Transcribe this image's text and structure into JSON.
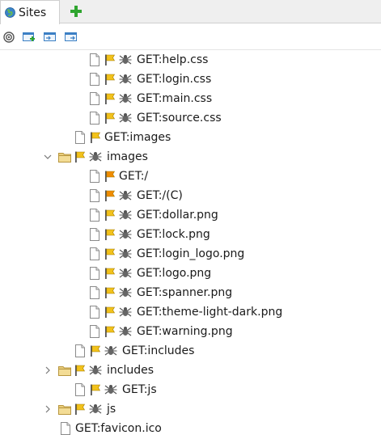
{
  "tab": {
    "label": "Sites",
    "icon": "globe-icon"
  },
  "toolbar": {
    "buttons": [
      "target-icon",
      "new-context-icon",
      "import-icon",
      "export-icon"
    ]
  },
  "tree": {
    "nodes": [
      {
        "label": "GET:help.css",
        "type": "file",
        "flag": true,
        "spider": true
      },
      {
        "label": "GET:login.css",
        "type": "file",
        "flag": true,
        "spider": true
      },
      {
        "label": "GET:main.css",
        "type": "file",
        "flag": true,
        "spider": true
      },
      {
        "label": "GET:source.css",
        "type": "file",
        "flag": true,
        "spider": true
      },
      {
        "label": "GET:images",
        "type": "file",
        "flag": true,
        "spider": false
      },
      {
        "label": "images",
        "type": "folder",
        "flag": true,
        "spider": true,
        "state": "expanded"
      },
      {
        "label": "GET:/",
        "type": "file",
        "flag": true,
        "spider": false
      },
      {
        "label": "GET:/(C)",
        "type": "file",
        "flag": true,
        "spider": true
      },
      {
        "label": "GET:dollar.png",
        "type": "file",
        "flag": true,
        "spider": true
      },
      {
        "label": "GET:lock.png",
        "type": "file",
        "flag": true,
        "spider": true
      },
      {
        "label": "GET:login_logo.png",
        "type": "file",
        "flag": true,
        "spider": true
      },
      {
        "label": "GET:logo.png",
        "type": "file",
        "flag": true,
        "spider": true
      },
      {
        "label": "GET:spanner.png",
        "type": "file",
        "flag": true,
        "spider": true
      },
      {
        "label": "GET:theme-light-dark.png",
        "type": "file",
        "flag": true,
        "spider": true
      },
      {
        "label": "GET:warning.png",
        "type": "file",
        "flag": true,
        "spider": true
      },
      {
        "label": "GET:includes",
        "type": "file",
        "flag": true,
        "spider": true
      },
      {
        "label": "includes",
        "type": "folder",
        "flag": true,
        "spider": true,
        "state": "collapsed"
      },
      {
        "label": "GET:js",
        "type": "file",
        "flag": true,
        "spider": true
      },
      {
        "label": "js",
        "type": "folder",
        "flag": true,
        "spider": true,
        "state": "collapsed"
      },
      {
        "label": "GET:favicon.ico",
        "type": "file",
        "flag": false,
        "spider": false
      }
    ]
  },
  "colors": {
    "flag_yellow": "#f2c21b",
    "flag_orange": "#f08c00",
    "add_green": "#2fa52f",
    "folder": "#e9cd7c"
  }
}
